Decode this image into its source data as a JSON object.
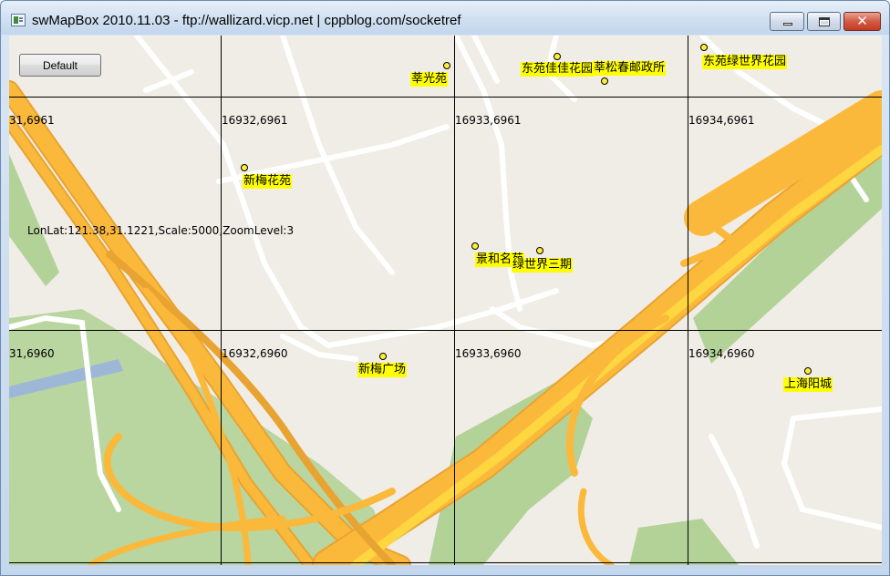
{
  "window": {
    "title": "swMapBox 2010.11.03 - ftp://wallizard.vicp.net | cppblog.com/socketref",
    "minimize_icon": "minimize-icon",
    "maximize_icon": "maximize-icon",
    "close_icon": "close-icon",
    "close_glyph": "✕"
  },
  "toolbar": {
    "default_label": "Default"
  },
  "status": {
    "info": "LonLat:121.38,31.1221,Scale:5000,ZoomLevel:3"
  },
  "tiles": [
    {
      "id": "t0",
      "label": "31,6961"
    },
    {
      "id": "t1",
      "label": "16932,6961"
    },
    {
      "id": "t2",
      "label": "16933,6961"
    },
    {
      "id": "t3",
      "label": "16934,6961"
    },
    {
      "id": "t4",
      "label": "31,6960"
    },
    {
      "id": "t5",
      "label": "16932,6960"
    },
    {
      "id": "t6",
      "label": "16933,6960"
    },
    {
      "id": "t7",
      "label": "16934,6960"
    }
  ],
  "pois": [
    {
      "id": "p0",
      "name": "莘光苑"
    },
    {
      "id": "p1",
      "name": "东苑佳佳花园"
    },
    {
      "id": "p2",
      "name": "莘松春邮政所"
    },
    {
      "id": "p3",
      "name": "东苑绿世界花园"
    },
    {
      "id": "p4",
      "name": "新梅花苑"
    },
    {
      "id": "p5",
      "name": "景和名苑"
    },
    {
      "id": "p6",
      "name": "绿世界三期"
    },
    {
      "id": "p7",
      "name": "新梅广场"
    },
    {
      "id": "p8",
      "name": "上海阳城"
    }
  ],
  "colors": {
    "map_bg": "#f0ede6",
    "road_minor": "#ffffff",
    "highway": "#fbb93c",
    "highway_edge": "#e8a331",
    "highway_core": "#fdd640",
    "green": "#b3d298",
    "water": "#9db8d6",
    "poi_label_bg": "#ffff00"
  }
}
